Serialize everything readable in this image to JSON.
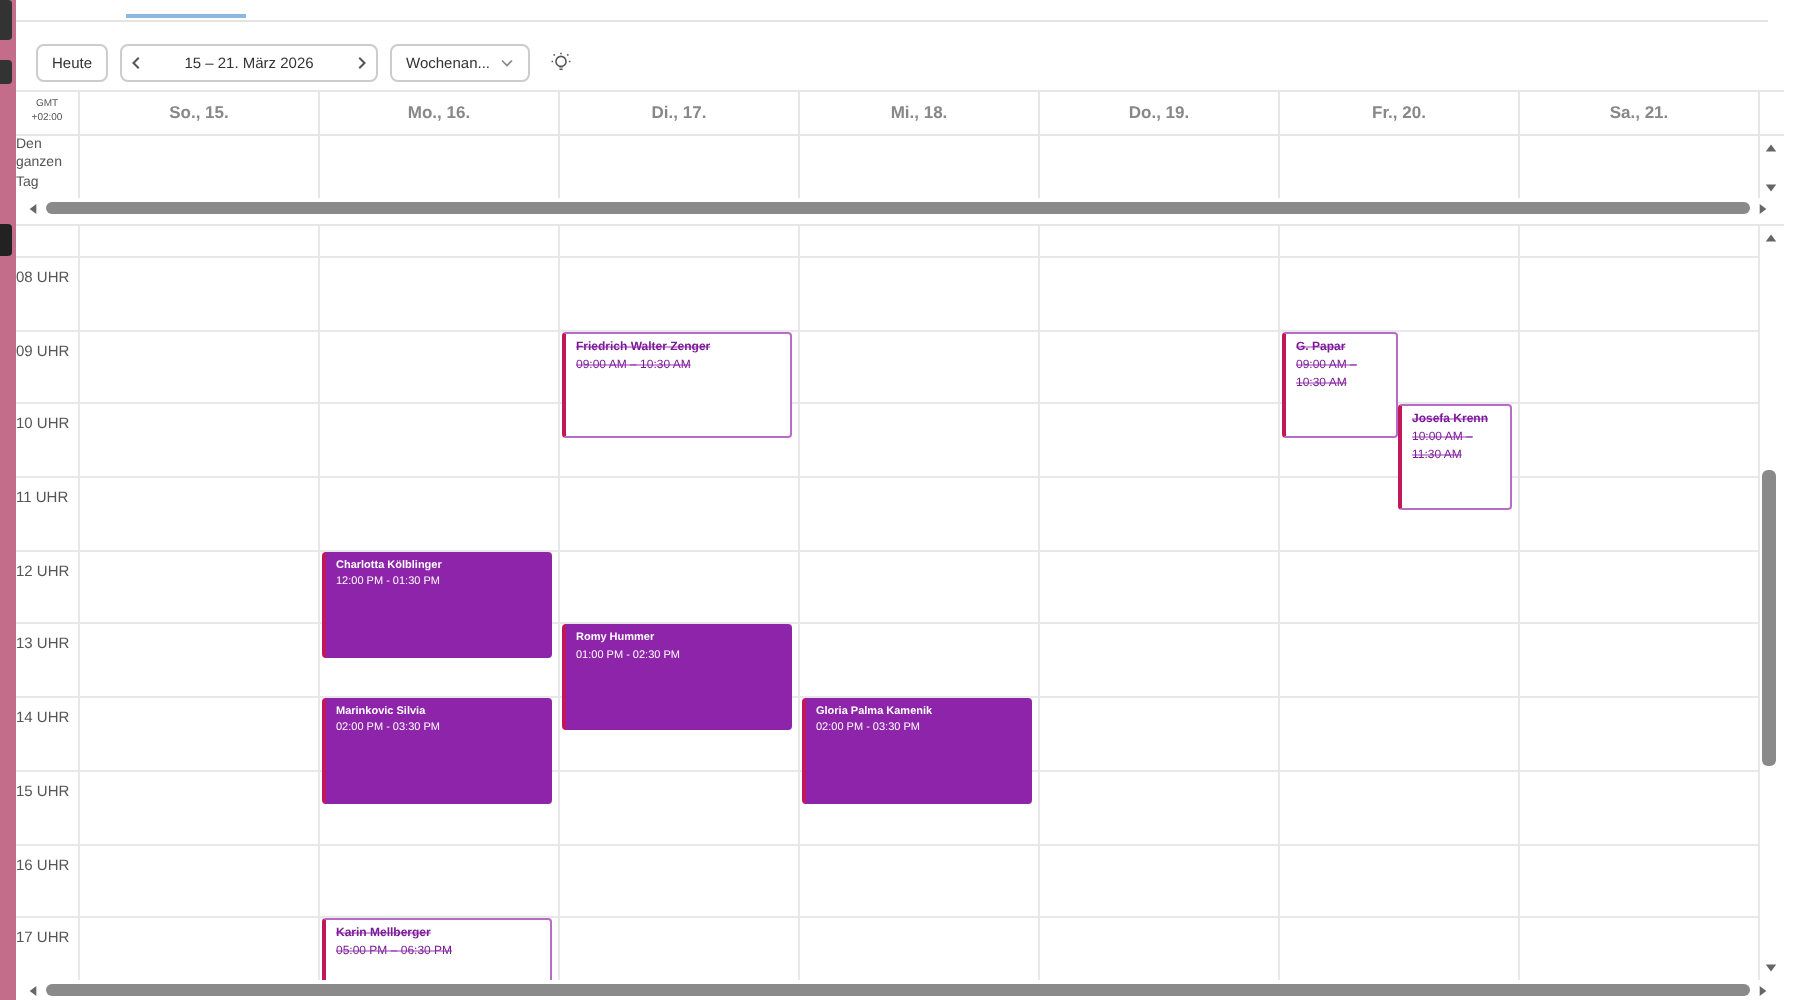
{
  "toolbar": {
    "today_button": "Heute",
    "date_range": "15 – 21. März 2026",
    "view_select": "Wochenan..."
  },
  "timezone": "GMT +02:00",
  "all_day_label": "Den ganzen Tag",
  "days": [
    {
      "label": "So., 15."
    },
    {
      "label": "Mo., 16."
    },
    {
      "label": "Di., 17."
    },
    {
      "label": "Mi., 18."
    },
    {
      "label": "Do., 19."
    },
    {
      "label": "Fr., 20."
    },
    {
      "label": "Sa., 21."
    }
  ],
  "hours": [
    {
      "label": "08 UHR",
      "cells": [
        {},
        {},
        {},
        {},
        {},
        {},
        {}
      ]
    },
    {
      "label": "09 UHR",
      "cells": [
        {},
        {},
        {
          "events": [
            {
              "kind": "cancelled",
              "title": "Friedrich Walter Zenger",
              "time": "09:00 AM – 10:30 AM"
            }
          ]
        },
        {},
        {},
        {
          "events": [
            {
              "kind": "cancelled",
              "narrow": true,
              "shifted": false,
              "title": "G. Papar",
              "time": "09:00 AM – 10:30 AM"
            }
          ]
        },
        {}
      ]
    },
    {
      "label": "10 UHR",
      "cells": [
        {},
        {},
        {},
        {},
        {},
        {
          "events": [
            {
              "kind": "cancelled",
              "narrow": true,
              "shifted": true,
              "title": "Josefa Krenn",
              "time": "10:00 AM – 11:30 AM"
            }
          ]
        },
        {}
      ]
    },
    {
      "label": "11 UHR",
      "cells": [
        {},
        {},
        {},
        {},
        {},
        {},
        {}
      ]
    },
    {
      "label": "12 UHR",
      "cells": [
        {},
        {
          "events": [
            {
              "kind": "solid",
              "title": "Charlotta Kölblinger",
              "time": "12:00 PM - 01:30 PM"
            }
          ]
        },
        {},
        {},
        {},
        {},
        {}
      ]
    },
    {
      "label": "13 UHR",
      "cells": [
        {},
        {},
        {
          "events": [
            {
              "kind": "solid",
              "title": "Romy Hummer",
              "time": "01:00 PM - 02:30 PM"
            }
          ]
        },
        {},
        {},
        {},
        {}
      ]
    },
    {
      "label": "14 UHR",
      "cells": [
        {},
        {
          "events": [
            {
              "kind": "solid",
              "title": "Marinkovic Silvia",
              "time": "02:00 PM - 03:30 PM"
            }
          ]
        },
        {},
        {
          "events": [
            {
              "kind": "solid",
              "title": "Gloria Palma Kamenik",
              "time": "02:00 PM - 03:30 PM"
            }
          ]
        },
        {},
        {},
        {}
      ]
    },
    {
      "label": "15 UHR",
      "cells": [
        {},
        {},
        {},
        {},
        {},
        {},
        {}
      ]
    },
    {
      "label": "16 UHR",
      "cells": [
        {},
        {},
        {},
        {},
        {},
        {},
        {}
      ]
    },
    {
      "label": "17 UHR",
      "cells": [
        {},
        {
          "events": [
            {
              "kind": "cancelled",
              "title": "Karin Mellberger",
              "time": "05:00 PM – 06:30 PM"
            }
          ]
        },
        {},
        {},
        {},
        {},
        {}
      ]
    }
  ]
}
